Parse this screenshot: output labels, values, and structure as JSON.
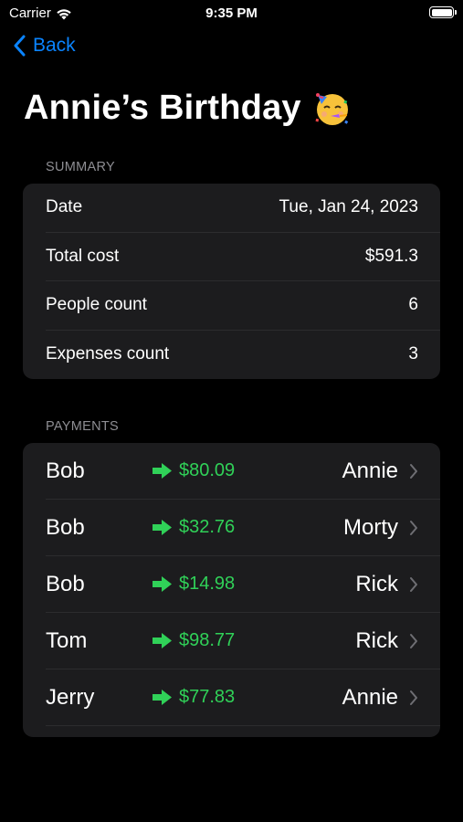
{
  "status_bar": {
    "carrier": "Carrier",
    "time": "9:35 PM"
  },
  "nav": {
    "back_label": "Back"
  },
  "title": "Annie’s Birthday",
  "title_emoji": "partying-face-icon",
  "summary": {
    "header": "SUMMARY",
    "rows": [
      {
        "label": "Date",
        "value": "Tue, Jan 24, 2023"
      },
      {
        "label": "Total cost",
        "value": "$591.3"
      },
      {
        "label": "People count",
        "value": "6"
      },
      {
        "label": "Expenses count",
        "value": "3"
      }
    ]
  },
  "payments": {
    "header": "PAYMENTS",
    "rows": [
      {
        "from": "Bob",
        "amount": "$80.09",
        "to": "Annie"
      },
      {
        "from": "Bob",
        "amount": "$32.76",
        "to": "Morty"
      },
      {
        "from": "Bob",
        "amount": "$14.98",
        "to": "Rick"
      },
      {
        "from": "Tom",
        "amount": "$98.77",
        "to": "Rick"
      },
      {
        "from": "Jerry",
        "amount": "$77.83",
        "to": "Annie"
      }
    ]
  },
  "colors": {
    "accent": "#0a84ff",
    "amount_green": "#30d158",
    "background": "#000000",
    "card": "#1c1c1e",
    "secondary_text": "#8e8e93"
  }
}
